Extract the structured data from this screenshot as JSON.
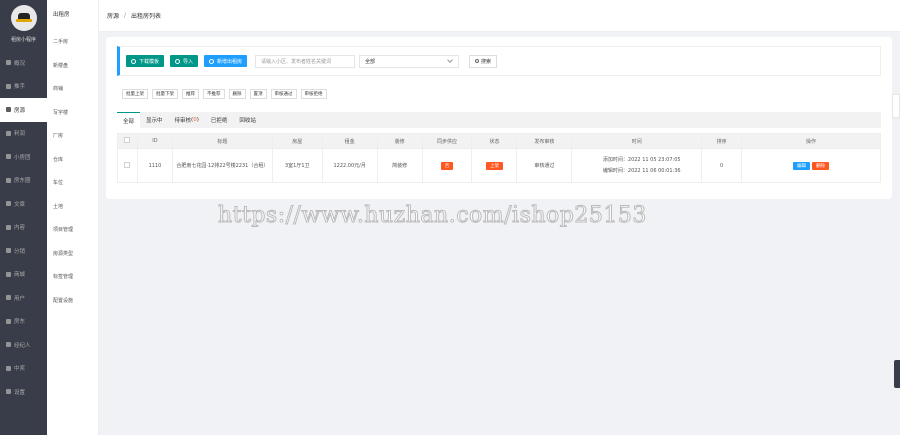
{
  "app": {
    "name": "租房小程序"
  },
  "sidebar": {
    "items": [
      {
        "label": "概况",
        "icon": "dashboard-icon",
        "active": false
      },
      {
        "label": "推手",
        "icon": "user-icon",
        "active": false
      },
      {
        "label": "房源",
        "icon": "house-icon",
        "active": true
      },
      {
        "label": "利润",
        "icon": "chart-icon",
        "active": false
      },
      {
        "label": "小房团",
        "icon": "group-icon",
        "active": false
      },
      {
        "label": "房东圈",
        "icon": "circle-icon",
        "active": false
      },
      {
        "label": "文章",
        "icon": "article-icon",
        "active": false
      },
      {
        "label": "内容",
        "icon": "content-icon",
        "active": false
      },
      {
        "label": "分销",
        "icon": "cart-icon",
        "active": false
      },
      {
        "label": "商城",
        "icon": "shop-icon",
        "active": false
      },
      {
        "label": "用户",
        "icon": "person-icon",
        "active": false
      },
      {
        "label": "房东",
        "icon": "landlord-icon",
        "active": false
      },
      {
        "label": "经纪人",
        "icon": "agent-icon",
        "active": false
      },
      {
        "label": "中奖",
        "icon": "prize-icon",
        "active": false
      },
      {
        "label": "设置",
        "icon": "gear-icon",
        "active": false
      }
    ]
  },
  "subnav": {
    "title": "出租房",
    "items": [
      "二手房",
      "新楼盘",
      "商铺",
      "写字楼",
      "厂房",
      "仓库",
      "车位",
      "土地",
      "项目管理",
      "房源类型",
      "标签管理",
      "配置设施"
    ]
  },
  "breadcrumb": {
    "root": "房源",
    "separator": "/",
    "current": "出租房列表"
  },
  "toolbar": {
    "download_label": "下载模板",
    "import_label": "导入",
    "add_label": "新增出租房",
    "search_placeholder": "请输入小区、发布者姓名关键词",
    "select_value": "全部",
    "search_label": "搜索"
  },
  "actions": [
    "批量上架",
    "批量下架",
    "推荐",
    "不推荐",
    "删除",
    "置顶",
    "审核通过",
    "审核拒绝"
  ],
  "tabs": [
    {
      "label": "全部",
      "count": ""
    },
    {
      "label": "显示中",
      "count": ""
    },
    {
      "label": "待审核",
      "count": "0"
    },
    {
      "label": "已拒绝",
      "count": ""
    },
    {
      "label": "回收站",
      "count": ""
    }
  ],
  "table": {
    "headers": [
      "",
      "ID",
      "标题",
      "房屋",
      "租金",
      "装修",
      "同步供应",
      "状态",
      "发布审核",
      "时间",
      "排序",
      "操作"
    ],
    "rows": [
      {
        "id": "1110",
        "title": "合肥南七花园·12排22号楼2231（合租）",
        "house": "3室1厅1卫",
        "rent": "1222.00元/月",
        "decoration": "简装修",
        "sync": "否",
        "status": "上架",
        "review": "审核通过",
        "created": "添加时间：2022 11 05 23:07:05",
        "updated": "编辑时间：2022 11 06 00:01:36",
        "sort": "0",
        "edit_label": "编辑",
        "delete_label": "删除"
      }
    ]
  },
  "watermark": "https://www.huzhan.com/ishop25153",
  "colors": {
    "sidebar": "#393d49",
    "primary": "#009688",
    "blue": "#1e9fff",
    "danger": "#ff5722"
  }
}
